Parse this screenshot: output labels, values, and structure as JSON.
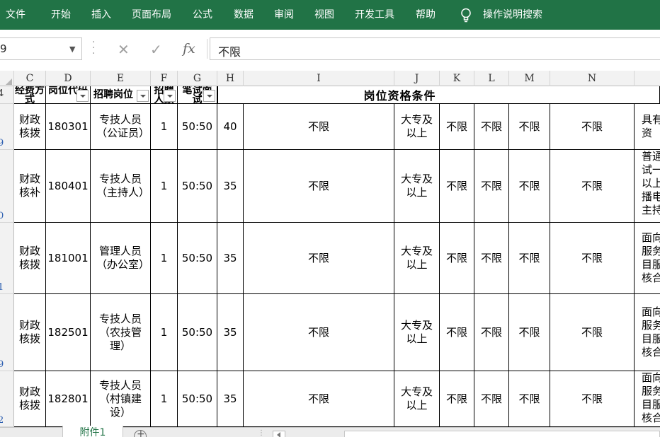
{
  "ribbon": {
    "tabs": [
      "文件",
      "开始",
      "插入",
      "页面布局",
      "公式",
      "数据",
      "审阅",
      "视图",
      "开发工具",
      "帮助"
    ],
    "search_label": "操作说明搜索"
  },
  "formula_bar": {
    "name_box": "9",
    "formula_value": "不限",
    "fx_label": "fx"
  },
  "columns": [
    "C",
    "D",
    "E",
    "F",
    "G",
    "H",
    "I",
    "J",
    "K",
    "L",
    "M",
    "N"
  ],
  "row_numbers": [
    "4",
    "9",
    "0",
    "1",
    "9",
    "2"
  ],
  "header_row": {
    "c": "经费方式",
    "d": "岗位代码",
    "e": "招聘岗位",
    "f": "招聘人数",
    "g": "笔试面试",
    "merged": "岗位资格条件"
  },
  "rows": [
    {
      "c": "财政核拨",
      "d": "180301",
      "e": "专技人员（公证员）",
      "f": "1",
      "g": "50:50",
      "h": "40",
      "i": "不限",
      "j": "大专及以上",
      "k": "不限",
      "l": "不限",
      "m": "不限",
      "n": "不限",
      "o": "具有资"
    },
    {
      "c": "财政核补",
      "d": "180401",
      "e": "专技人员（主持人）",
      "f": "1",
      "g": "50:50",
      "h": "35",
      "i": "不限",
      "j": "大专及以上",
      "k": "不限",
      "l": "不限",
      "m": "不限",
      "n": "不限",
      "o": "普通试一以上播电主持"
    },
    {
      "c": "财政核拨",
      "d": "181001",
      "e": "管理人员（办公室）",
      "f": "1",
      "g": "50:50",
      "h": "35",
      "i": "不限",
      "j": "大专及以上",
      "k": "不限",
      "l": "不限",
      "m": "不限",
      "n": "不限",
      "o": "面向服务目服核合"
    },
    {
      "c": "财政核拨",
      "d": "182501",
      "e": "专技人员（农技管理）",
      "f": "1",
      "g": "50:50",
      "h": "35",
      "i": "不限",
      "j": "大专及以上",
      "k": "不限",
      "l": "不限",
      "m": "不限",
      "n": "不限",
      "o": "面向服务目服核合"
    },
    {
      "c": "财政核拨",
      "d": "182801",
      "e": "专技人员（村镇建设）",
      "f": "1",
      "g": "50:50",
      "h": "35",
      "i": "不限",
      "j": "大专及以上",
      "k": "不限",
      "l": "不限",
      "m": "不限",
      "n": "不限",
      "o": "面向服务目服核合"
    }
  ],
  "sheet_tab": "附件1"
}
